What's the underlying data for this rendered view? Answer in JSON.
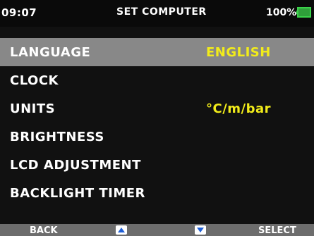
{
  "status": {
    "time": "09:07",
    "title": "SET COMPUTER",
    "battery": "100%"
  },
  "menu": {
    "items": [
      {
        "label": "LANGUAGE",
        "value": "ENGLISH",
        "selected": true
      },
      {
        "label": "CLOCK",
        "value": ""
      },
      {
        "label": "UNITS",
        "value": "°C/m/bar"
      },
      {
        "label": "BRIGHTNESS",
        "value": ""
      },
      {
        "label": "LCD ADJUSTMENT",
        "value": ""
      },
      {
        "label": "BACKLIGHT TIMER",
        "value": ""
      }
    ]
  },
  "softkeys": {
    "left": "BACK",
    "up_icon": "arrow-up-icon",
    "down_icon": "arrow-down-icon",
    "right": "SELECT"
  },
  "colors": {
    "value_yellow": "#f2ec1a",
    "selected_row": "#888888",
    "battery_green": "#3bd24a",
    "softkey_bar": "#6d6d6d",
    "arrow_blue": "#1f5fd6"
  }
}
